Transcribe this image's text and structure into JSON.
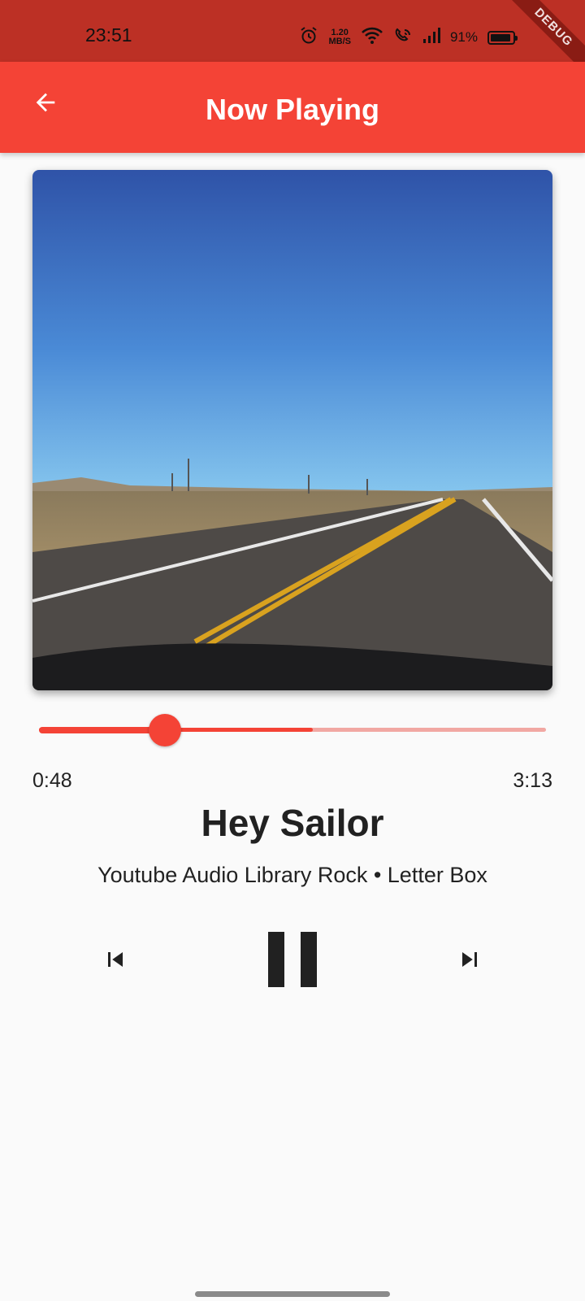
{
  "status_bar": {
    "time": "23:51",
    "net_speed_value": "1.20",
    "net_speed_unit": "MB/S",
    "battery": "91%",
    "icons": [
      "alarm-icon",
      "wifi-icon",
      "wifi-call-icon",
      "signal-icon",
      "battery-icon"
    ]
  },
  "debug_banner": "DEBUG",
  "app_bar": {
    "title": "Now Playing",
    "back_icon": "arrow-back-icon",
    "color": "#f44336"
  },
  "player": {
    "progress": 0.248,
    "buffered": 0.54,
    "elapsed": "0:48",
    "total": "3:13",
    "title": "Hey Sailor",
    "subtitle": "Youtube Audio Library Rock • Letter Box",
    "controls": [
      "skip-previous-icon",
      "pause-icon",
      "skip-next-icon"
    ]
  },
  "album_art": {
    "description_icon": "desert-road-artwork",
    "sky_top": "#2f53a8",
    "sky_bottom": "#7cc0ec",
    "road": "#4e4a47"
  }
}
